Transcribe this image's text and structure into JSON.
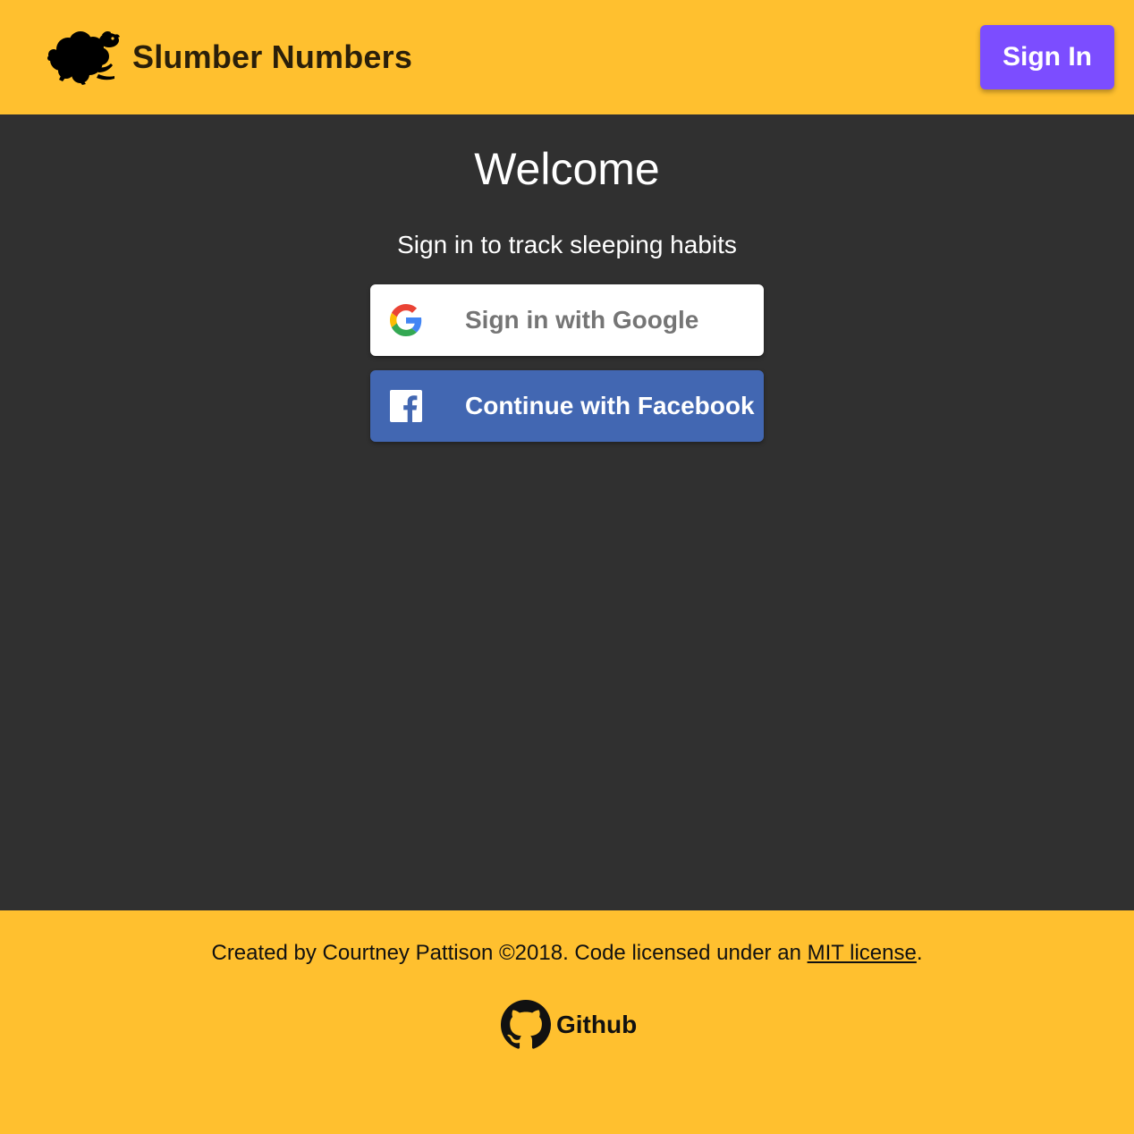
{
  "header": {
    "app_name": "Slumber Numbers",
    "logo_icon": "sheep-icon",
    "sign_in_label": "Sign In",
    "background_color": "#FFC02F",
    "sign_in_color": "#7C4DFF"
  },
  "main": {
    "title": "Welcome",
    "subtitle": "Sign in to track sleeping habits",
    "background_color": "#303030",
    "auth_buttons": [
      {
        "label": "Sign in with Google",
        "icon": "google-icon",
        "background": "#FFFFFF"
      },
      {
        "label": "Continue with Facebook",
        "icon": "facebook-icon",
        "background": "#4267B2"
      }
    ]
  },
  "footer": {
    "credits_prefix": "Created by Courtney Pattison ©2018. Code licensed under an ",
    "license_link": "MIT license",
    "credits_suffix": ".",
    "github_label": "Github",
    "github_icon": "github-icon"
  }
}
